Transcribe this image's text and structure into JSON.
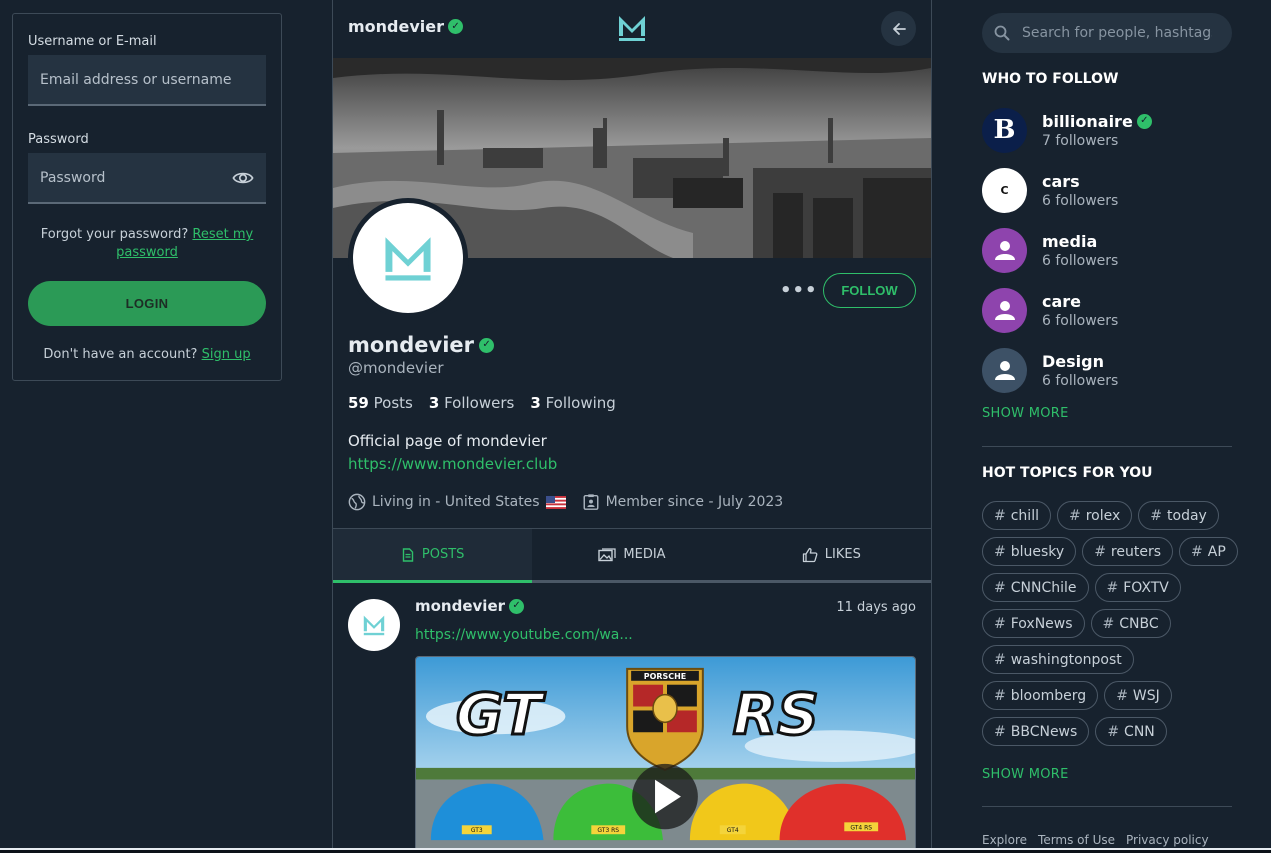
{
  "login": {
    "username_label": "Username or E-mail",
    "username_placeholder": "Email address or username",
    "password_label": "Password",
    "password_placeholder": "Password",
    "forgot_text": "Forgot your password?",
    "reset_link": "Reset my password",
    "login_button": "LOGIN",
    "no_account_text": "Don't have an account?",
    "signup_link": "Sign up"
  },
  "profile": {
    "topbar_name": "mondevier",
    "name": "mondevier",
    "handle": "@mondevier",
    "follow_button": "FOLLOW",
    "more_button": "•••",
    "posts_count": "59",
    "posts_label": "Posts",
    "followers_count": "3",
    "followers_label": "Followers",
    "following_count": "3",
    "following_label": "Following",
    "bio": "Official page of mondevier",
    "website": "https://www.mondevier.club",
    "location": "Living in - United States",
    "member_since": "Member since - July 2023"
  },
  "tabs": [
    {
      "label": "POSTS",
      "active": true
    },
    {
      "label": "MEDIA",
      "active": false
    },
    {
      "label": "LIKES",
      "active": false
    }
  ],
  "post": {
    "author": "mondevier",
    "time": "11 days ago",
    "link": "https://www.youtube.com/wa...",
    "thumb_text_left": "GT",
    "thumb_text_right": "RS",
    "badge_text": "PORSCHE",
    "plates": [
      "GT3",
      "GT3 RS",
      "GT4",
      "GT4 RS"
    ]
  },
  "search": {
    "placeholder": "Search for people, hashtags"
  },
  "who_to_follow": {
    "title": "WHO TO FOLLOW",
    "show_more": "SHOW MORE",
    "items": [
      {
        "name": "billionaire",
        "followers": "7 followers",
        "verified": true,
        "avatar_letter": "B"
      },
      {
        "name": "cars",
        "followers": "6 followers",
        "verified": false,
        "avatar_letter": "C"
      },
      {
        "name": "media",
        "followers": "6 followers",
        "verified": false
      },
      {
        "name": "care",
        "followers": "6 followers",
        "verified": false
      },
      {
        "name": "Design",
        "followers": "6 followers",
        "verified": false
      }
    ]
  },
  "hot_topics": {
    "title": "HOT TOPICS FOR YOU",
    "show_more": "SHOW MORE",
    "hash": "#",
    "items": [
      "chill",
      "rolex",
      "today",
      "bluesky",
      "reuters",
      "AP",
      "CNNChile",
      "FOXTV",
      "FoxNews",
      "CNBC",
      "washingtonpost",
      "bloomberg",
      "WSJ",
      "BBCNews",
      "CNN"
    ]
  },
  "footer": {
    "links": [
      "Explore",
      "Terms of Use",
      "Privacy policy"
    ]
  },
  "colors": {
    "accent": "#2fbf6a",
    "background": "#17222e",
    "panel": "#253341",
    "logo_teal": "#6fd1d4",
    "purple_avatar": "#8e44ad",
    "slate_avatar": "#3d5166"
  }
}
